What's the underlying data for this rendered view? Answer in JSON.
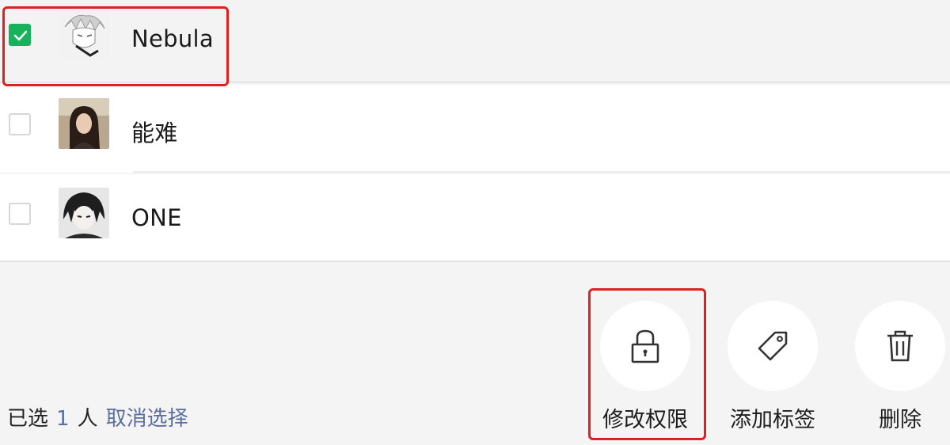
{
  "members": [
    {
      "name": "Nebula",
      "checked": true,
      "avatar_icon": "avatar-anime-white-hair"
    },
    {
      "name": "能难",
      "checked": false,
      "avatar_icon": "avatar-photo-woman"
    },
    {
      "name": "ONE",
      "checked": false,
      "avatar_icon": "avatar-anime-dark-hair"
    }
  ],
  "footer": {
    "prefix": "已选",
    "count": "1",
    "suffix": "人",
    "cancel_label": "取消选择"
  },
  "actions": [
    {
      "label": "修改权限",
      "icon": "lock-icon"
    },
    {
      "label": "添加标签",
      "icon": "tag-icon"
    },
    {
      "label": "删除",
      "icon": "trash-icon"
    }
  ],
  "colors": {
    "checked_green": "#16b35c",
    "highlight_red": "#e02020",
    "link_blue": "#5b6e9e"
  }
}
